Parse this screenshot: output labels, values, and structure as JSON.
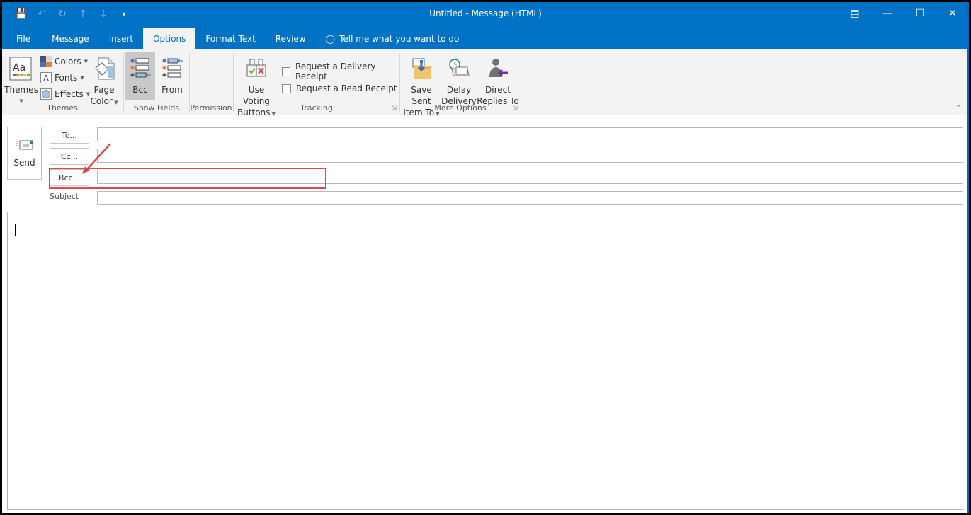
{
  "window": {
    "title": "Untitled - Message (HTML)",
    "qat_icons": [
      "save-icon",
      "undo-icon",
      "redo-icon",
      "up-arrow-icon",
      "down-arrow-icon",
      "customize-qat-icon"
    ],
    "controls": [
      "ribbon-display-options-icon",
      "minimize-icon",
      "maximize-icon",
      "close-icon"
    ]
  },
  "tabs": [
    {
      "label": "File"
    },
    {
      "label": "Message"
    },
    {
      "label": "Insert"
    },
    {
      "label": "Options",
      "active": true
    },
    {
      "label": "Format Text"
    },
    {
      "label": "Review"
    }
  ],
  "tell_me": "Tell me what you want to do",
  "ribbon": {
    "themes_group": {
      "label": "Themes",
      "themes": "Themes",
      "colors": "Colors",
      "fonts": "Fonts",
      "effects": "Effects",
      "page_color_1": "Page",
      "page_color_2": "Color"
    },
    "show_fields_group": {
      "label": "Show Fields",
      "bcc": "Bcc",
      "from": "From"
    },
    "permission_group": {
      "label": "Permission"
    },
    "tracking_group": {
      "label": "Tracking",
      "voting_1": "Use Voting",
      "voting_2": "Buttons",
      "delivery_receipt": "Request a Delivery Receipt",
      "read_receipt": "Request a Read Receipt"
    },
    "more_options_group": {
      "label": "More Options",
      "save_sent_1": "Save Sent",
      "save_sent_2": "Item To",
      "delay_1": "Delay",
      "delay_2": "Delivery",
      "direct_1": "Direct",
      "direct_2": "Replies To"
    }
  },
  "compose": {
    "send": "Send",
    "to": "To...",
    "cc": "Cc...",
    "bcc": "Bcc...",
    "subject": "Subject",
    "to_value": "",
    "cc_value": "",
    "bcc_value": "",
    "subject_value": "",
    "body_value": ""
  },
  "annotation": {
    "color": "#e0474c"
  }
}
